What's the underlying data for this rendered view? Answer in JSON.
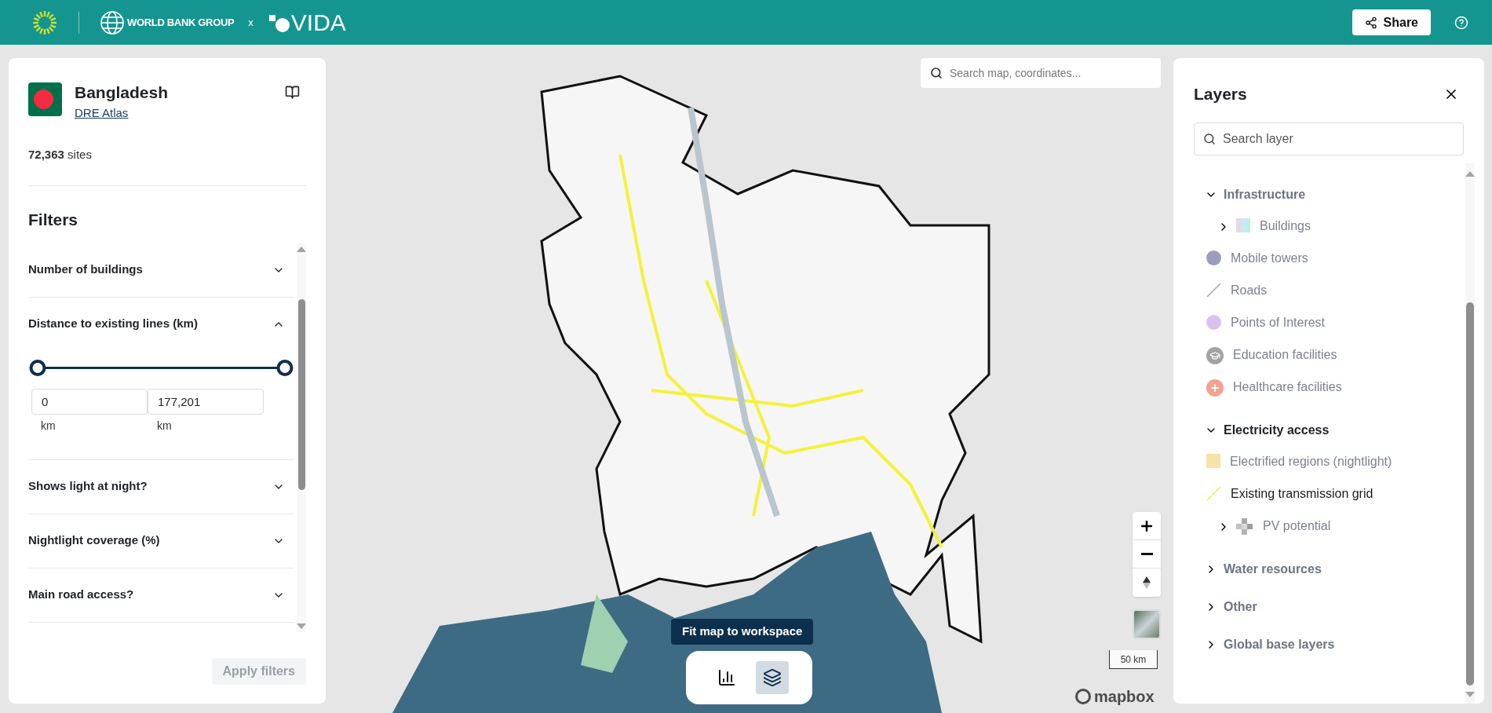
{
  "header": {
    "org": "WORLD BANK GROUP",
    "separator": "x",
    "partner": "VIDA",
    "share": "Share"
  },
  "country_panel": {
    "title": "Bangladesh",
    "link": "DRE Atlas",
    "sites": "**72,363** sites",
    "filters_title": "Filters",
    "filters": [
      {
        "label": "Number of buildings",
        "expanded": false
      },
      {
        "label": "Distance to existing lines (km)",
        "expanded": true,
        "range": {
          "thumbs": [
            {
              "level": 0
            },
            {
              "level": 1
            }
          ],
          "inputs": [
            {
              "value": "0",
              "unit": "km"
            },
            {
              "value": "177,201",
              "unit": "km"
            }
          ]
        }
      },
      {
        "label": "Shows light at night?",
        "expanded": false
      },
      {
        "label": "Nightlight coverage (%)",
        "expanded": false
      },
      {
        "label": "Main road access?",
        "expanded": false
      }
    ],
    "apply_button": {
      "label": "Apply filters",
      "disabled": true
    }
  },
  "map": {
    "search_placeholder": "Search map, coordinates...",
    "scale": "50 km",
    "attribution": "mapbox",
    "tooltip": "Fit map to workspace",
    "toolbar": [
      {
        "kind": "chart",
        "selected": false
      },
      {
        "kind": "layers",
        "selected": true
      }
    ]
  },
  "layers_panel": {
    "title": "Layers",
    "search_placeholder": "Search layer",
    "tree": [
      {
        "label": "Infrastructure",
        "expanded": true,
        "on": false,
        "children": [
          {
            "label": "Buildings",
            "kind": "gradient",
            "expanded": false,
            "on": false
          },
          {
            "label": "Mobile towers",
            "kind": "dot",
            "color": "#9c9cbc",
            "on": false
          },
          {
            "label": "Roads",
            "kind": "line",
            "color": "#a3a3a3",
            "on": false
          },
          {
            "label": "Points of Interest",
            "kind": "dot",
            "color": "#d9c2f2",
            "on": false
          },
          {
            "label": "Education facilities",
            "kind": "school",
            "color": "#a3a3a3",
            "on": false
          },
          {
            "label": "Healthcare facilities",
            "kind": "plus",
            "color": "#f2a392",
            "on": false
          }
        ]
      },
      {
        "label": "Electricity access",
        "expanded": true,
        "on": true,
        "children": [
          {
            "label": "Electrified regions (nightlight)",
            "kind": "square",
            "color": "#f7e2a8",
            "on": false
          },
          {
            "label": "Existing transmission grid",
            "kind": "line",
            "color": "#f2f24a",
            "on": true
          },
          {
            "label": "PV potential",
            "kind": "checker",
            "expanded": false,
            "on": false
          }
        ]
      },
      {
        "label": "Water resources",
        "expanded": false,
        "on": false
      },
      {
        "label": "Other",
        "expanded": false,
        "on": false
      },
      {
        "label": "Global base layers",
        "expanded": false,
        "on": false
      }
    ]
  }
}
